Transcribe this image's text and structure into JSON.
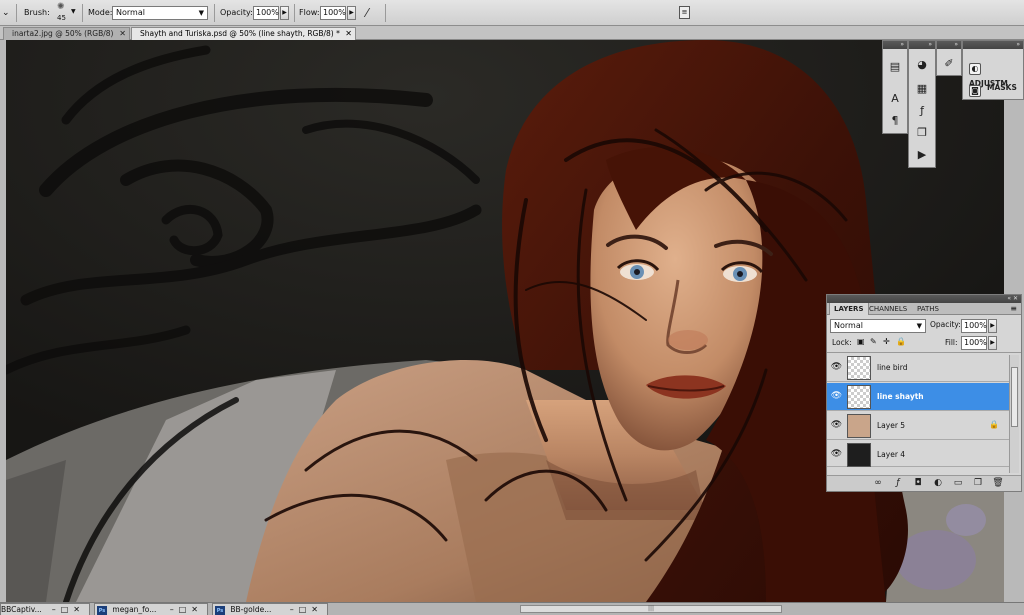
{
  "options_bar": {
    "brush_label": "Brush:",
    "brush_size": "45",
    "mode_label": "Mode:",
    "mode_value": "Normal",
    "opacity_label": "Opacity:",
    "opacity_value": "100%",
    "flow_label": "Flow:",
    "flow_value": "100%"
  },
  "tabs": [
    {
      "label": "inarta2.jpg @ 50% (RGB/8)",
      "active": false
    },
    {
      "label": "Shayth and Turiska.psd @ 50% (line shayth, RGB/8) *",
      "active": true
    }
  ],
  "close_glyph": "✕",
  "side_panels": {
    "adjustments_label": "ADJUSTM",
    "masks_label": "MASKS"
  },
  "layers_panel": {
    "tabs": [
      "LAYERS",
      "CHANNELS",
      "PATHS"
    ],
    "blend_mode": "Normal",
    "opacity_label": "Opacity:",
    "opacity_value": "100%",
    "lock_label": "Lock:",
    "fill_label": "Fill:",
    "fill_value": "100%",
    "layers": [
      {
        "name": "line bird",
        "selected": false,
        "locked": false
      },
      {
        "name": "line shayth",
        "selected": true,
        "locked": false
      },
      {
        "name": "Layer 5",
        "selected": false,
        "locked": true
      },
      {
        "name": "Layer 4",
        "selected": false,
        "locked": false
      }
    ]
  },
  "taskbar": {
    "docs": [
      {
        "label": "BBCaptiv..."
      },
      {
        "label": "megan_fo..."
      },
      {
        "label": "BB-golde..."
      }
    ],
    "ps_badge": "Ps",
    "window_controls": "–□✕"
  },
  "colors": {
    "selected_layer": "#3d8ee6",
    "hair": "#3f1106",
    "skin": "#c48f6c",
    "eyes": "#6a90b4"
  }
}
